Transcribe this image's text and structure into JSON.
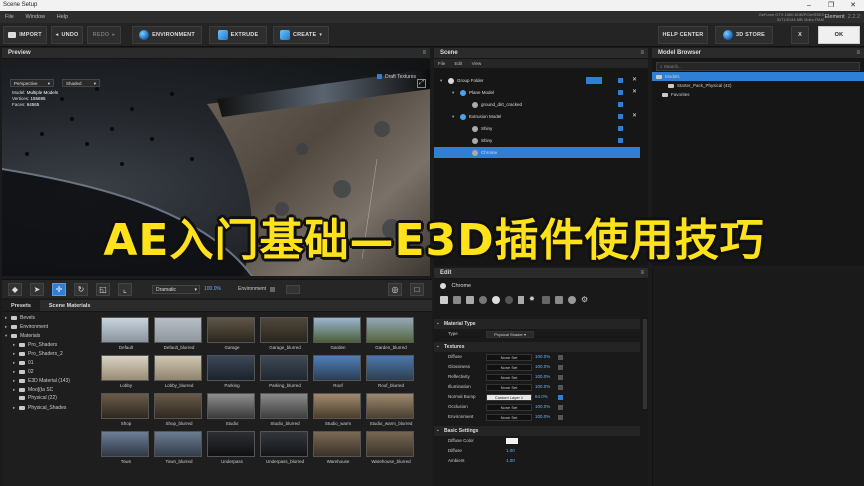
{
  "window": {
    "title": "Scene Setup"
  },
  "menu": [
    "File",
    "Window",
    "Help"
  ],
  "gpu": {
    "line1": "GeForce GTX 1060 6GB/PCIe/SSE2",
    "line2": "3171/6144 MB Video RAM"
  },
  "brand": {
    "name": "Element",
    "version": "2.2.2"
  },
  "toolbar": {
    "import": "IMPORT",
    "undo": "UNDO",
    "redo": "REDO",
    "environment": "ENVIRONMENT",
    "extrude": "EXTRUDE",
    "create": "CREATE",
    "help_center": "HELP CENTER",
    "store": "3D STORE",
    "x": "X",
    "ok": "OK"
  },
  "preview": {
    "title": "Preview",
    "draft_label": "Draft Textures",
    "camera": "Perspective",
    "shading": "Shaded",
    "stats": [
      {
        "label": "Model:",
        "value": "Multiple Models"
      },
      {
        "label": "Vertices:",
        "value": "155695"
      },
      {
        "label": "Faces:",
        "value": "64565"
      }
    ]
  },
  "viewport_bar": {
    "lighting": "Dramatic",
    "lighting_value": "100.0%",
    "environment_label": "Environment"
  },
  "presets": {
    "tabs": [
      "Presets",
      "Scene Materials"
    ],
    "tree": [
      {
        "label": "Bevels",
        "indent": 0,
        "arrow": "▸"
      },
      {
        "label": "Environment",
        "indent": 0,
        "arrow": "▸"
      },
      {
        "label": "Materials",
        "indent": 0,
        "arrow": "▾"
      },
      {
        "label": "Pro_Shaders",
        "indent": 1,
        "arrow": "▸"
      },
      {
        "label": "Pro_Shaders_2",
        "indent": 1,
        "arrow": "▸"
      },
      {
        "label": "01",
        "indent": 1,
        "arrow": "▸"
      },
      {
        "label": "02",
        "indent": 1,
        "arrow": "▸"
      },
      {
        "label": "E3D Material (143)",
        "indent": 1,
        "arrow": "▸"
      },
      {
        "label": "Moo](ta SC",
        "indent": 1,
        "arrow": "▸"
      },
      {
        "label": "Physical (22)",
        "indent": 1,
        "arrow": ""
      },
      {
        "label": "Physical_Shades",
        "indent": 1,
        "arrow": "▸"
      }
    ],
    "thumbnails": [
      "Default",
      "Default_blurred",
      "Garage",
      "Garage_blurred",
      "Garden",
      "Garden_blurred",
      "Lobby",
      "Lobby_blurred",
      "Parking",
      "Parking_blurred",
      "Roof",
      "Roof_blurred",
      "Shop",
      "Shop_blurred",
      "Studio",
      "Studio_blurred",
      "Studio_warm",
      "Studio_warm_blurred",
      "Town",
      "Town_blurred",
      "Underpass",
      "Underpass_blurred",
      "Warehouse",
      "Warehouse_blurred"
    ]
  },
  "scene": {
    "title": "Scene",
    "menu": [
      "File",
      "Edit",
      "View"
    ],
    "rows": [
      {
        "label": "Group Folder",
        "indent": 0,
        "arrow": "▾",
        "icon": "folder",
        "x": true,
        "selected": false
      },
      {
        "label": "Plane Model",
        "indent": 1,
        "arrow": "▾",
        "icon": "model",
        "x": true,
        "selected": false
      },
      {
        "label": "ground_dirt_cracked",
        "indent": 2,
        "arrow": "",
        "icon": "mat",
        "x": false,
        "selected": false
      },
      {
        "label": "Extrusion Model",
        "indent": 1,
        "arrow": "▾",
        "icon": "model",
        "x": true,
        "selected": false
      },
      {
        "label": "Shiny",
        "indent": 2,
        "arrow": "",
        "icon": "mat",
        "x": false,
        "selected": false
      },
      {
        "label": "Shiny",
        "indent": 2,
        "arrow": "",
        "icon": "mat",
        "x": false,
        "selected": false
      },
      {
        "label": "Chrome",
        "indent": 2,
        "arrow": "",
        "icon": "mat",
        "x": false,
        "selected": true
      }
    ]
  },
  "model_browser": {
    "title": "Model Browser",
    "search_placeholder": "Search...",
    "rows": [
      {
        "label": "Models",
        "indent": 0,
        "selected": true
      },
      {
        "label": "Starter_Pack_Physical (42)",
        "indent": 2,
        "selected": false
      },
      {
        "label": "Favorites",
        "indent": 1,
        "selected": false
      }
    ]
  },
  "edit": {
    "title": "Edit",
    "material_name": "Chrome",
    "material_type": {
      "label": "Material Type",
      "type_label": "Type",
      "value": "Physical Shader"
    },
    "textures_label": "Textures",
    "textures": [
      {
        "label": "Diffuse",
        "value": "None Set",
        "pct": "100.0%",
        "on": false,
        "hl": false
      },
      {
        "label": "Glossiness",
        "value": "None Set",
        "pct": "100.0%",
        "on": false,
        "hl": false
      },
      {
        "label": "Reflectivity",
        "value": "None Set",
        "pct": "100.0%",
        "on": false,
        "hl": false
      },
      {
        "label": "Illumination",
        "value": "None Set",
        "pct": "100.0%",
        "on": false,
        "hl": false
      },
      {
        "label": "Normal Bump",
        "value": "Custom Layer 1",
        "pct": "64.0%",
        "on": true,
        "hl": true
      },
      {
        "label": "Occlusion",
        "value": "None Set",
        "pct": "100.0%",
        "on": false,
        "hl": false
      },
      {
        "label": "Environment",
        "value": "None Set",
        "pct": "100.0%",
        "on": false,
        "hl": false
      }
    ],
    "basic_label": "Basic Settings",
    "basic": [
      {
        "label": "Diffuse Color",
        "value": ""
      },
      {
        "label": "Diffuse",
        "value": "1.00"
      },
      {
        "label": "Ambient",
        "value": "1.00"
      }
    ]
  },
  "overlay": {
    "text": "AE入门基础—E3D插件使用技巧"
  },
  "colors": {
    "accent": "#2f7fd6",
    "overlay": "#ffe21a"
  }
}
